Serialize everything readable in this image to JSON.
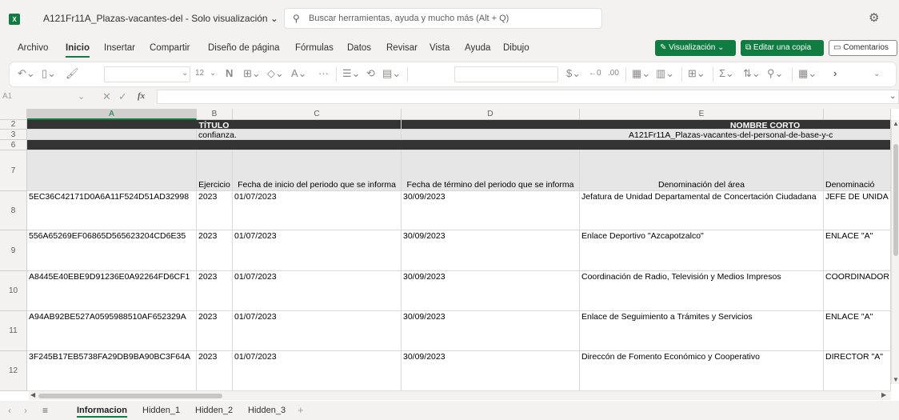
{
  "titlebar": {
    "logo": "X",
    "title": "A121Fr11A_Plazas-vacantes-del - Solo visualización ⌄",
    "search_placeholder": "Buscar herramientas, ayuda y mucho más (Alt + Q)"
  },
  "menu": {
    "items": [
      "Archivo",
      "Inicio",
      "Insertar",
      "Compartir",
      "Diseño de página",
      "Fórmulas",
      "Datos",
      "Revisar",
      "Vista",
      "Ayuda",
      "Dibujo"
    ],
    "view_button": "Visualización ⌄",
    "copy_button": "Editar una copia",
    "comments_button": "Comentarios"
  },
  "ribbon": {
    "font_size": "12"
  },
  "formulabar": {
    "namebox": "A1",
    "fx": "fx"
  },
  "columns": [
    "A",
    "B",
    "C",
    "D",
    "E",
    ""
  ],
  "rows": {
    "r2": {
      "num": "2",
      "titulo": "TÍTULO",
      "nombre": "NOMBRE CORTO"
    },
    "r3": {
      "num": "3",
      "b": "confianza.",
      "e": "A121Fr11A_Plazas-vacantes-del-personal-de-base-y-c"
    },
    "r6": {
      "num": "6"
    },
    "r7": {
      "num": "7",
      "b": "Ejercicio",
      "c": "Fecha de inicio del periodo que se informa",
      "d": "Fecha de término del periodo que se informa",
      "e": "Denominación del área",
      "f": "Denominació"
    },
    "data": [
      {
        "num": "8",
        "a": "5EC36C42171D0A6A11F524D51AD32998",
        "b": "2023",
        "c": "01/07/2023",
        "d": "30/09/2023",
        "e": "Jefatura de Unidad Departamental de Concertación Ciudadana",
        "f": "JEFE DE UNIDA"
      },
      {
        "num": "9",
        "a": "556A65269EF06865D565623204CD6E35",
        "b": "2023",
        "c": "01/07/2023",
        "d": "30/09/2023",
        "e": "Enlace Deportivo \"Azcapotzalco\"",
        "f": "ENLACE \"A\""
      },
      {
        "num": "10",
        "a": "A8445E40EBE9D91236E0A92264FD6CF1",
        "b": "2023",
        "c": "01/07/2023",
        "d": "30/09/2023",
        "e": "Coordinación de Radio, Televisión y Medios Impresos",
        "f": "COORDINADOR"
      },
      {
        "num": "11",
        "a": "A94AB92BE527A0595988510AF652329A",
        "b": "2023",
        "c": "01/07/2023",
        "d": "30/09/2023",
        "e": "Enlace de Seguimiento a Trámites y Servicios",
        "f": "ENLACE \"A\""
      },
      {
        "num": "12",
        "a": "3F245B17EB5738FA29DB9BA90BC3F64A",
        "b": "2023",
        "c": "01/07/2023",
        "d": "30/09/2023",
        "e": "Direccón de Fomento Económico y Cooperativo",
        "f": "DIRECTOR \"A\""
      }
    ]
  },
  "sheets": [
    "Informacion",
    "Hidden_1",
    "Hidden_2",
    "Hidden_3"
  ],
  "colors": {
    "accent": "#107c41",
    "dark_header": "#333333"
  }
}
